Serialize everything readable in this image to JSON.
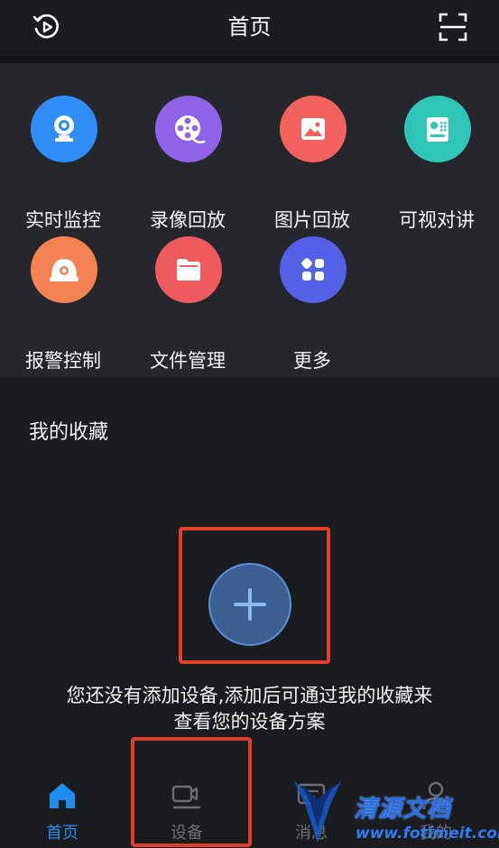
{
  "header": {
    "title": "首页",
    "left_icon": "history-play-icon",
    "right_icon": "scan-icon"
  },
  "grid": {
    "items": [
      {
        "label": "实时监控",
        "icon": "camera-icon",
        "color": "#2f8df5"
      },
      {
        "label": "录像回放",
        "icon": "film-reel-icon",
        "color": "#8e63e8"
      },
      {
        "label": "图片回放",
        "icon": "image-icon",
        "color": "#f3625f"
      },
      {
        "label": "可视对讲",
        "icon": "intercom-icon",
        "color": "#2ec7b6"
      },
      {
        "label": "报警控制",
        "icon": "alarm-icon",
        "color": "#f48354"
      },
      {
        "label": "文件管理",
        "icon": "folder-icon",
        "color": "#ee5b5e"
      },
      {
        "label": "更多",
        "icon": "apps-icon",
        "color": "#5660e6"
      }
    ]
  },
  "favorites": {
    "title": "我的收藏",
    "empty_line1": "您还没有添加设备,添加后可通过我的收藏来",
    "empty_line2": "查看您的设备方案",
    "add_icon": "plus-icon"
  },
  "bottom_nav": {
    "items": [
      {
        "label": "首页",
        "icon": "home-icon",
        "active": true
      },
      {
        "label": "设备",
        "icon": "device-camera-icon",
        "active": false
      },
      {
        "label": "消息",
        "icon": "message-icon",
        "active": false
      },
      {
        "label": "我的",
        "icon": "person-icon",
        "active": false
      }
    ]
  },
  "watermark": {
    "brand": "清源文档",
    "url": "www.fotimeit.com"
  },
  "colors": {
    "background": "#1b1c20",
    "panel": "#26272c",
    "accent": "#1f8cf0",
    "highlight_box": "#e13d2c"
  }
}
